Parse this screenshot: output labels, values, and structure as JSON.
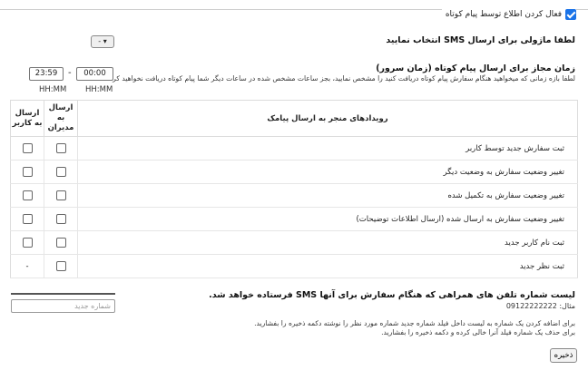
{
  "enable": {
    "label": "فعال کردن اطلاع توسط پیام کوتاه",
    "checked": true
  },
  "module": {
    "title": "لطفا ماژولی برای ارسال SMS انتخاب نمایید",
    "select_value": "-"
  },
  "time": {
    "title": "زمان مجاز برای ارسال پیام کوتاه (زمان سرور)",
    "note": "لطفا بازه زمانی که میخواهید هنگام سفارش پیام کوتاه دریافت کنید را مشخص نمایید، بجز ساعات مشخص شده در ساعات دیگر شما پیام کوتاه دریافت نخواهید کرد.",
    "from_value": "00:00",
    "to_value": "23:59",
    "separator": "-",
    "from_format": "HH:MM",
    "to_format": "HH:MM"
  },
  "events": {
    "header": "رویدادهای منجر به ارسال پیامک",
    "col_admin": "ارسال به مدیران",
    "col_user": "ارسال به کاربر",
    "rows": [
      {
        "label": "ثبت سفارش جدید توسط کاربر",
        "user": "checkbox"
      },
      {
        "label": "تغییر وضعیت سفارش به وضعیت دیگر",
        "user": "checkbox"
      },
      {
        "label": "تغییر وضعیت سفارش به تکمیل شده",
        "user": "checkbox"
      },
      {
        "label": "تغییر وضعیت سفارش به ارسال شده (ارسال اطلاعات توضیحات)",
        "user": "checkbox"
      },
      {
        "label": "ثبت نام کاربر جدید",
        "user": "checkbox"
      },
      {
        "label": "ثبت نظر جدید",
        "user": "-"
      }
    ]
  },
  "phones": {
    "title": "لیست شماره تلفن های همراهی که هنگام سفارش برای آنها SMS فرستاده خواهد شد.",
    "example": "مثال: 09122222222",
    "new_placeholder": "شماره جدید",
    "help_add_bold": "اضافه کردن",
    "help_add": "برای اضافه کردن یک شماره به لیست داخل فیلد شماره جدید شماره مورد نظر را نوشته دکمه ذخیره را بفشارید.",
    "help_del_bold": "حذف",
    "help_del": "برای حذف یک شماره فیلد آنرا خالی کرده و دکمه ذخیره را بفشارید."
  },
  "save_label": "ذخیره"
}
